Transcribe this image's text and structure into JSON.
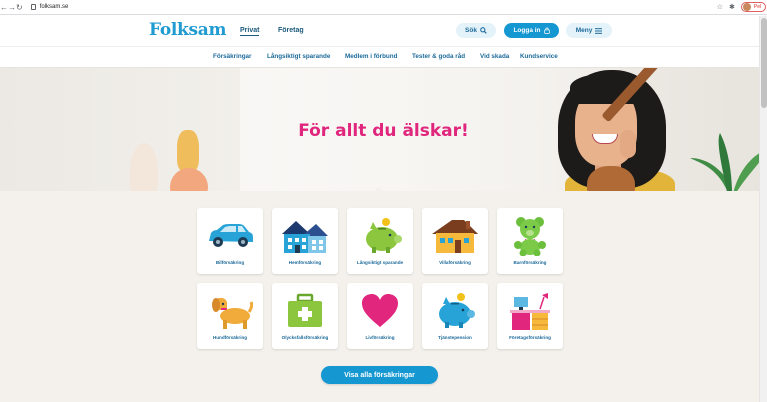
{
  "browser": {
    "url": "folksam.se",
    "profile_label": "Pel",
    "back_icon": "←",
    "forward_icon": "→",
    "reload_icon": "↻",
    "star_icon": "☆",
    "extensions_icon": "✱",
    "menu_icon": "⋮"
  },
  "header": {
    "logo": "Folksam",
    "tabs": [
      {
        "label": "Privat",
        "active": true
      },
      {
        "label": "Företag",
        "active": false
      }
    ],
    "search_label": "Sök",
    "login_label": "Logga in",
    "menu_label": "Meny"
  },
  "subnav": {
    "items": [
      "Försäkringar",
      "Långsiktigt sparande",
      "Medlem i förbund",
      "Tester & goda råd",
      "Vid skada",
      "Kundservice"
    ]
  },
  "hero": {
    "headline": "För allt du älskar!"
  },
  "cards": [
    {
      "label": "Bilförsäkring",
      "icon": "car-icon"
    },
    {
      "label": "Hemförsäkring",
      "icon": "apartment-icon"
    },
    {
      "label": "Långsiktigt sparande",
      "icon": "piggy-bank-icon"
    },
    {
      "label": "Villaförsäkring",
      "icon": "house-icon"
    },
    {
      "label": "Barnförsäkring",
      "icon": "teddy-bear-icon"
    },
    {
      "label": "Hundförsäkring",
      "icon": "dog-icon"
    },
    {
      "label": "Olycksfallsförsäkring",
      "icon": "first-aid-kit-icon"
    },
    {
      "label": "Livförsäkring",
      "icon": "heart-icon"
    },
    {
      "label": "Tjänstepension",
      "icon": "piggy-bank-coin-icon"
    },
    {
      "label": "Företagsförsäkring",
      "icon": "office-desk-icon"
    }
  ],
  "cta_label": "Visa alla försäkringar",
  "colors": {
    "brand_blue": "#1597d2",
    "headline_pink": "#e0267d",
    "link_blue": "#1c6a9a"
  }
}
